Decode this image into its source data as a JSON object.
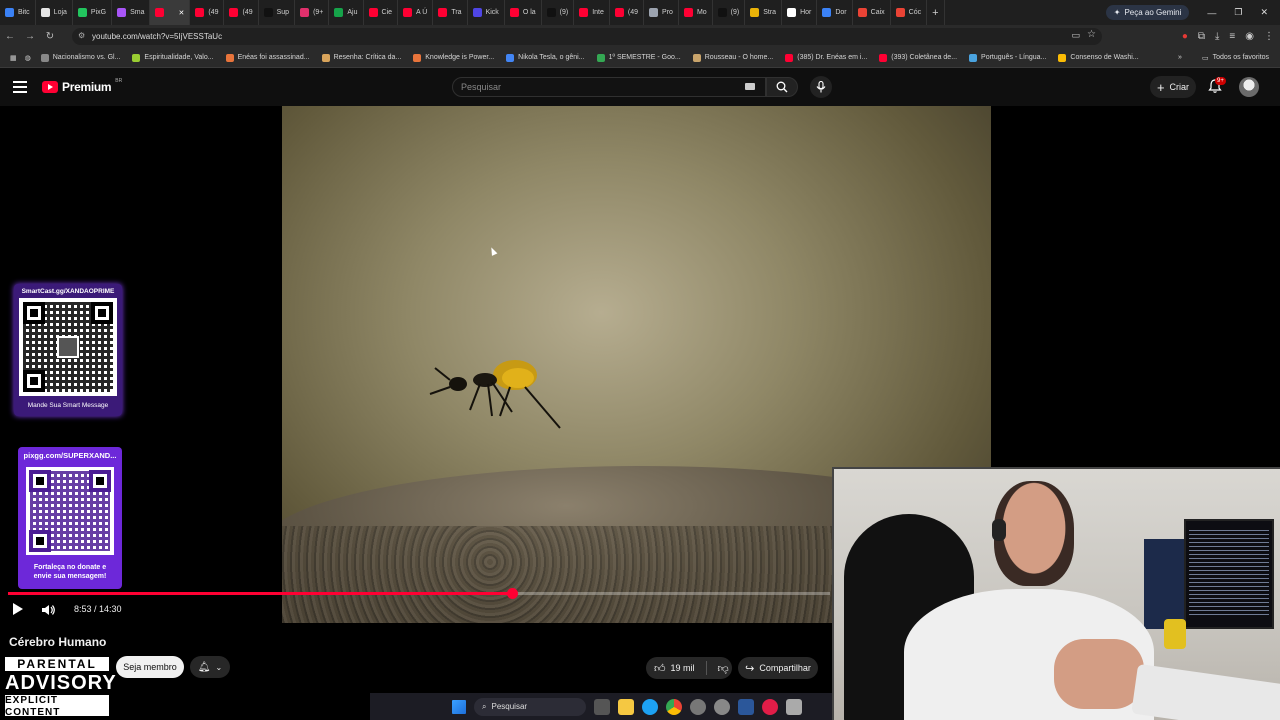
{
  "browser": {
    "tabs": [
      {
        "label": "Bitc",
        "color": "#3b82f6"
      },
      {
        "label": "Loja",
        "color": "#e5e5e5"
      },
      {
        "label": "PixG",
        "color": "#22c55e"
      },
      {
        "label": "Sma",
        "color": "#a855f7"
      },
      {
        "label": "",
        "color": "#ff0033",
        "active": true
      },
      {
        "label": "(49",
        "color": "#ff0033"
      },
      {
        "label": "(49",
        "color": "#ff0033"
      },
      {
        "label": "Sup",
        "color": "#111111"
      },
      {
        "label": "(9+",
        "color": "#e1306c"
      },
      {
        "label": "Aju",
        "color": "#16a34a"
      },
      {
        "label": "Cie",
        "color": "#ff0033"
      },
      {
        "label": "A Ú",
        "color": "#ff0033"
      },
      {
        "label": "Tra",
        "color": "#ff0033"
      },
      {
        "label": "Kick",
        "color": "#4f46e5"
      },
      {
        "label": "O la",
        "color": "#ff0033"
      },
      {
        "label": "(9)",
        "color": "#111111"
      },
      {
        "label": "Inte",
        "color": "#ff0033"
      },
      {
        "label": "(49",
        "color": "#ff0033"
      },
      {
        "label": "Pro",
        "color": "#9ca3af"
      },
      {
        "label": "Mo",
        "color": "#ff0033"
      },
      {
        "label": "(9)",
        "color": "#111111"
      },
      {
        "label": "Stra",
        "color": "#eab308"
      },
      {
        "label": "Hor",
        "color": "#ffffff"
      },
      {
        "label": "Dor",
        "color": "#3b82f6"
      },
      {
        "label": "Caix",
        "color": "#ea4335"
      },
      {
        "label": "Cóc",
        "color": "#ea4335"
      }
    ],
    "gemini_label": "Peça ao Gemini",
    "url": "youtube.com/watch?v=5IjVESSTaUc",
    "bookmarks": [
      "Nacionalismo vs. Gl...",
      "Espiritualidade, Valo...",
      "Enéas foi assassinad...",
      "Resenha: Crítica da...",
      "Knowledge is Power...",
      "Nikola Tesla, o gêni...",
      "1º SEMESTRE - Goo...",
      "Rousseau - O home...",
      "(385) Dr. Enéas em i...",
      "(393) Coletânea de...",
      "Português - Língua...",
      "Consenso de Washi..."
    ],
    "all_bookmarks_label": "Todos os favoritos"
  },
  "youtube": {
    "logo_text": "Premium",
    "logo_badge": "BR",
    "search_placeholder": "Pesquisar",
    "create_label": "Criar",
    "notifications_badge": "9+",
    "video": {
      "time_current": "8:53",
      "time_total": "14:30",
      "time_display": "8:53 / 14:30",
      "progress": 0.6126
    },
    "title": "Cérebro Humano",
    "join_label": "Seja membro",
    "likes": "19 mil",
    "share_label": "Compartilhar"
  },
  "overlays": {
    "qr1_top": "SmartCast.gg/XANDAOPRIME",
    "qr1_bottom": "Mande Sua Smart Message",
    "qr2_top": "pixgg.com/SUPERXAND...",
    "qr2_bottom": "Fortaleça no donate e envie sua mensagem!",
    "advisory_line1": "PARENTAL",
    "advisory_line2": "ADVISORY",
    "advisory_line3": "EXPLICIT CONTENT"
  },
  "taskbar": {
    "search_label": "Pesquisar"
  },
  "colors": {
    "brand_red": "#ff0033",
    "qr_frame": "#5b21b6"
  }
}
